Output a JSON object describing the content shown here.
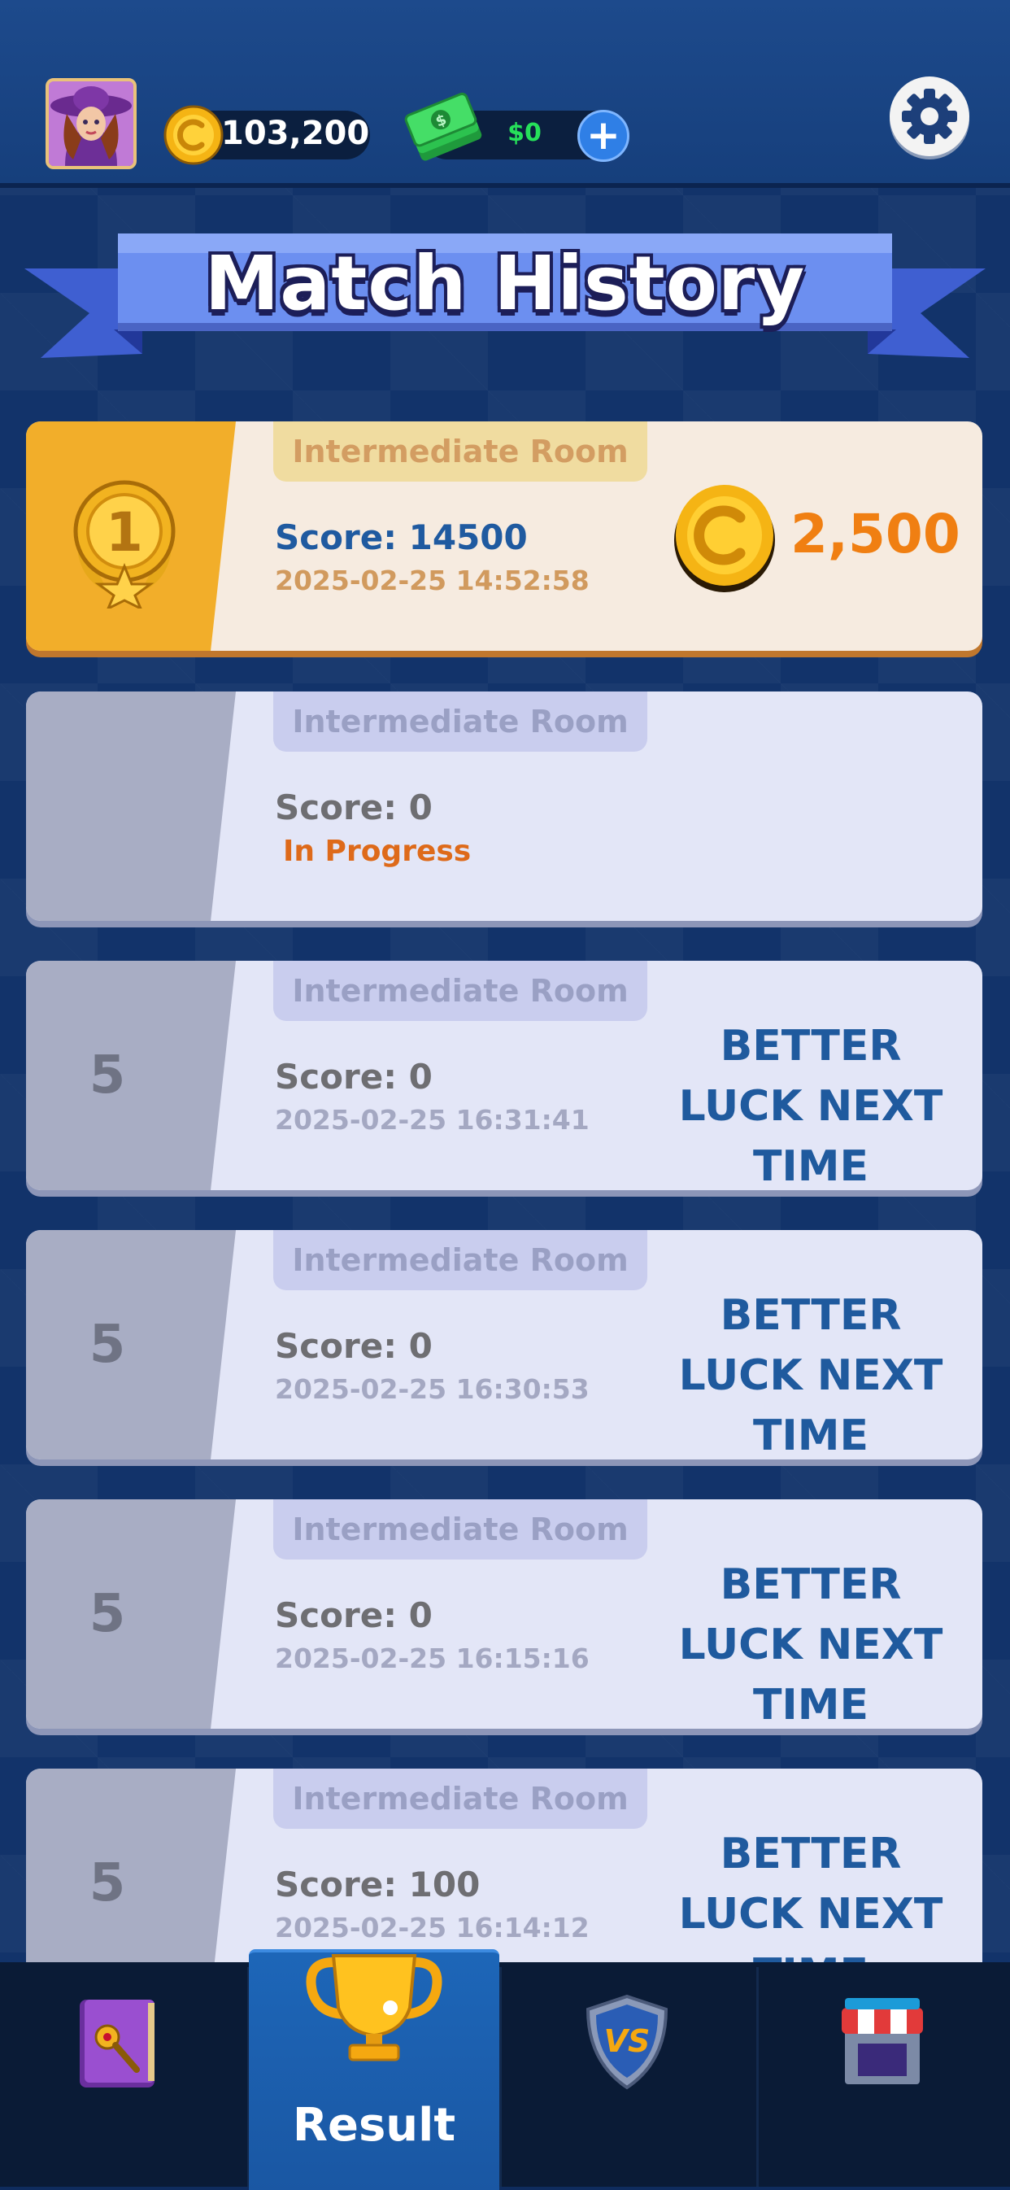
{
  "header": {
    "coins": "103,200",
    "cash": "$0",
    "plus_label": "+"
  },
  "page": {
    "title": "Match History"
  },
  "matches": [
    {
      "room": "Intermediate Room",
      "score": "Score: 14500",
      "date": "2025-02-25 14:52:58",
      "prize": "2,500",
      "rank": "1"
    },
    {
      "room": "Intermediate Room",
      "score": "Score: 0",
      "status": "In Progress"
    },
    {
      "room": "Intermediate Room",
      "score": "Score: 0",
      "date": "2025-02-25 16:31:41",
      "rank": "5",
      "result": "BETTER LUCK NEXT TIME"
    },
    {
      "room": "Intermediate Room",
      "score": "Score: 0",
      "date": "2025-02-25 16:30:53",
      "rank": "5",
      "result": "BETTER LUCK NEXT TIME"
    },
    {
      "room": "Intermediate Room",
      "score": "Score: 0",
      "date": "2025-02-25 16:15:16",
      "rank": "5",
      "result": "BETTER LUCK NEXT TIME"
    },
    {
      "room": "Intermediate Room",
      "score": "Score: 100",
      "date": "2025-02-25 16:14:12",
      "rank": "5",
      "result": "BETTER LUCK NEXT TIME"
    }
  ],
  "nav": {
    "items": [
      {
        "icon": "spellbook-icon"
      },
      {
        "icon": "trophy-icon",
        "label": "Result",
        "active": true
      },
      {
        "icon": "vs-shield-icon"
      },
      {
        "icon": "shop-icon"
      }
    ]
  },
  "colors": {
    "background": "#12336a",
    "winner_card": "#f6ebe0",
    "winner_accent": "#f2ae2a",
    "card": "#e3e6f7",
    "prize": "#f07f12",
    "status_in_progress": "#de6a1a",
    "result_text": "#1f5a9e"
  }
}
